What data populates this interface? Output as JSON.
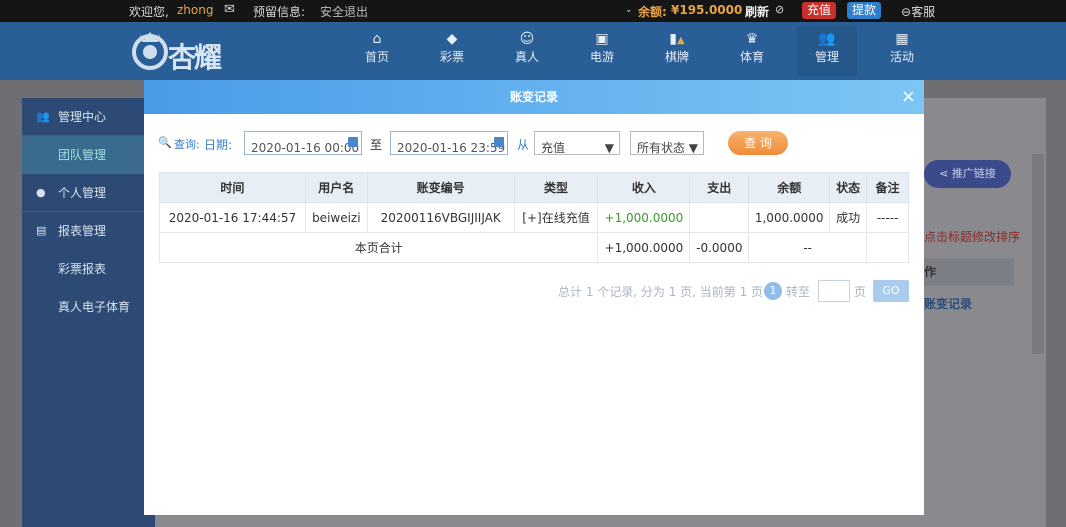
{
  "topbar": {
    "welcome": "欢迎您,",
    "username": "zhong",
    "warning": "预留信息:",
    "logout": "安全退出",
    "balance_label": "余额:",
    "balance_value": "¥195.0000",
    "refresh": "刷新",
    "recharge": "充值",
    "withdraw": "提款",
    "service": "客服"
  },
  "nav": {
    "logo_text": "杏耀",
    "items": [
      "首页",
      "彩票",
      "真人",
      "电游",
      "棋牌",
      "体育",
      "管理",
      "活动"
    ]
  },
  "sidebar": {
    "management_center": "管理中心",
    "team_management": "团队管理",
    "personal_management": "个人管理",
    "report_management": "报表管理",
    "lottery_report": "彩票报表",
    "live_report": "真人电子体育"
  },
  "background": {
    "promo_link": "推广链接",
    "sort_hint": "点击标题修改排序",
    "op_header": "作",
    "account_record": "账变记录"
  },
  "modal": {
    "title": "账变记录",
    "close": "×",
    "query_label": "查询:",
    "date_label": "日期:",
    "start_date": "2020-01-16 00:00",
    "to": "至",
    "end_date": "2020-01-16 23:59",
    "from": "从",
    "type_select": "充值",
    "status_select": "所有状态",
    "query_button": "查 询",
    "columns": [
      "时间",
      "用户名",
      "账变编号",
      "类型",
      "收入",
      "支出",
      "余额",
      "状态",
      "备注"
    ],
    "rows": [
      {
        "time": "2020-01-16 17:44:57",
        "user": "beiweizi",
        "id": "20200116VBGIJIIJAK",
        "type": "[+]在线充值",
        "income": "+1,000.0000",
        "expense": "",
        "balance": "1,000.0000",
        "status": "成功",
        "note": "-----"
      }
    ],
    "subtotal": {
      "label": "本页合计",
      "income": "+1,000.0000",
      "expense": "-0.0000",
      "balance": "--"
    },
    "pager": {
      "summary": "总计 1 个记录, 分为 1 页, 当前第 1 页",
      "current": "1",
      "goto": "转至",
      "page": "页",
      "go": "GO"
    }
  },
  "colors": {
    "accent": "#4a9be8",
    "income": "#3a9a2a",
    "query_btn": "#ee8b3a"
  }
}
